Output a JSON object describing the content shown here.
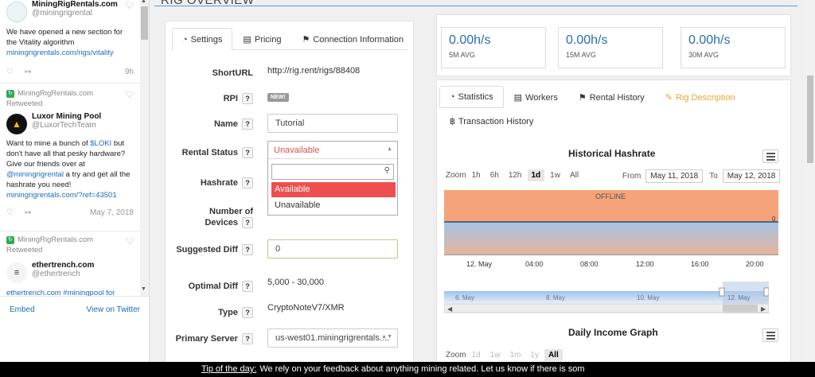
{
  "twitter": {
    "tweets": [
      {
        "name": "MiningRigRentals.com",
        "handle": "@miningrigrental",
        "text": "We have opened a new section for the Vitality algorithm",
        "link": "miningrigrentals.com/rigs/vitality",
        "time": "9h"
      },
      {
        "retweet_by": "MiningRigRentals.com",
        "retweeted_label": "Retweeted",
        "name": "Luxor Mining Pool",
        "handle": "@LuxorTechTeam",
        "text_pre": "Want to mine a bunch of ",
        "text_tag": "$LOKI",
        "text_mid": " but don't have all that pesky hardware? Give our friends over at ",
        "text_mention": "@miningrigrental",
        "text_post": " a try and get all the hashrate you need!",
        "link": "miningrigrentals.com/?ref=43501",
        "time": "May 7, 2018"
      },
      {
        "retweet_by": "MiningRigRentals.com",
        "retweeted_label": "Retweeted",
        "name": "ethertrench.com",
        "handle": "@ethertrench",
        "text": "ethertrench.com #miningpool for"
      }
    ],
    "footer": {
      "embed": "Embed",
      "view": "View on Twitter"
    }
  },
  "page": {
    "section_title": "RIG OVERVIEW"
  },
  "settings_tabs": [
    {
      "label": "Settings",
      "icon": "dashboard-icon"
    },
    {
      "label": "Pricing",
      "icon": "money-icon"
    },
    {
      "label": "Connection Information",
      "icon": "plug-icon"
    }
  ],
  "fields": {
    "shorturl": {
      "label": "ShortURL",
      "value": "http://rig.rent/rigs/88408"
    },
    "rpi": {
      "label": "RPI",
      "badge": "NEW!"
    },
    "name": {
      "label": "Name",
      "value": "Tutorial"
    },
    "rental_status": {
      "label": "Rental Status",
      "value": "Unavailable",
      "options": [
        "Available",
        "Unavailable"
      ]
    },
    "hashrate": {
      "label": "Hashrate"
    },
    "devices": {
      "label1": "Number of",
      "label2": "Devices"
    },
    "suggested_diff": {
      "label": "Suggested Diff",
      "value": "0"
    },
    "optimal_diff": {
      "label": "Optimal Diff",
      "value": "5,000 - 30,000"
    },
    "type": {
      "label": "Type",
      "value": "CryptoNoteV7/XMR"
    },
    "primary_server": {
      "label": "Primary Server",
      "value": "us-west01.miningrigrentals...."
    }
  },
  "q": "?",
  "stats": [
    {
      "value": "0.00h/s",
      "label": "5M AVG"
    },
    {
      "value": "0.00h/s",
      "label": "15M AVG"
    },
    {
      "value": "0.00h/s",
      "label": "30M AVG"
    }
  ],
  "stats_tabs": [
    {
      "label": "Statistics",
      "icon": "dashboard-icon"
    },
    {
      "label": "Workers",
      "icon": "server-icon"
    },
    {
      "label": "Rental History",
      "icon": "flag-icon"
    },
    {
      "label": "Rig Description",
      "icon": "edit-icon"
    },
    {
      "label": "Transaction History",
      "icon": "bitcoin-icon"
    }
  ],
  "hashrate_chart": {
    "title": "Historical Hashrate",
    "zoom_label": "Zoom",
    "zoom_options": [
      "1h",
      "6h",
      "12h",
      "1d",
      "1w",
      "All"
    ],
    "from_label": "From",
    "from": "May 11, 2018",
    "to_label": "To",
    "to": "May 12, 2018",
    "band_label": "OFFLINE",
    "x_ticks": [
      "12. May",
      "04:00",
      "08:00",
      "12:00",
      "16:00",
      "20:00"
    ],
    "y_value_label": "0",
    "nav_ticks": [
      "6. May",
      "8. May",
      "10. May",
      "12. May"
    ]
  },
  "chart_data": {
    "type": "area",
    "x": [
      "12. May",
      "04:00",
      "08:00",
      "12:00",
      "16:00",
      "20:00"
    ],
    "series": [
      {
        "values": [
          0,
          0,
          0,
          0,
          0,
          0
        ]
      }
    ],
    "ylim": [
      0,
      0
    ],
    "bands": [
      "OFFLINE"
    ]
  },
  "income_chart": {
    "title": "Daily Income Graph",
    "zoom_label": "Zoom",
    "zoom_options": [
      "1d",
      "1w",
      "1m",
      "1y",
      "All"
    ]
  },
  "tip": {
    "label": "Tip of the day:",
    "text": "We rely on your feedback about anything mining related. Let us know if there is som"
  },
  "colors": {
    "accent": "#2a6db5",
    "offline": "#f4a37a",
    "highlight": "#ef4e4e",
    "twitter_link": "#1b6bbd"
  }
}
